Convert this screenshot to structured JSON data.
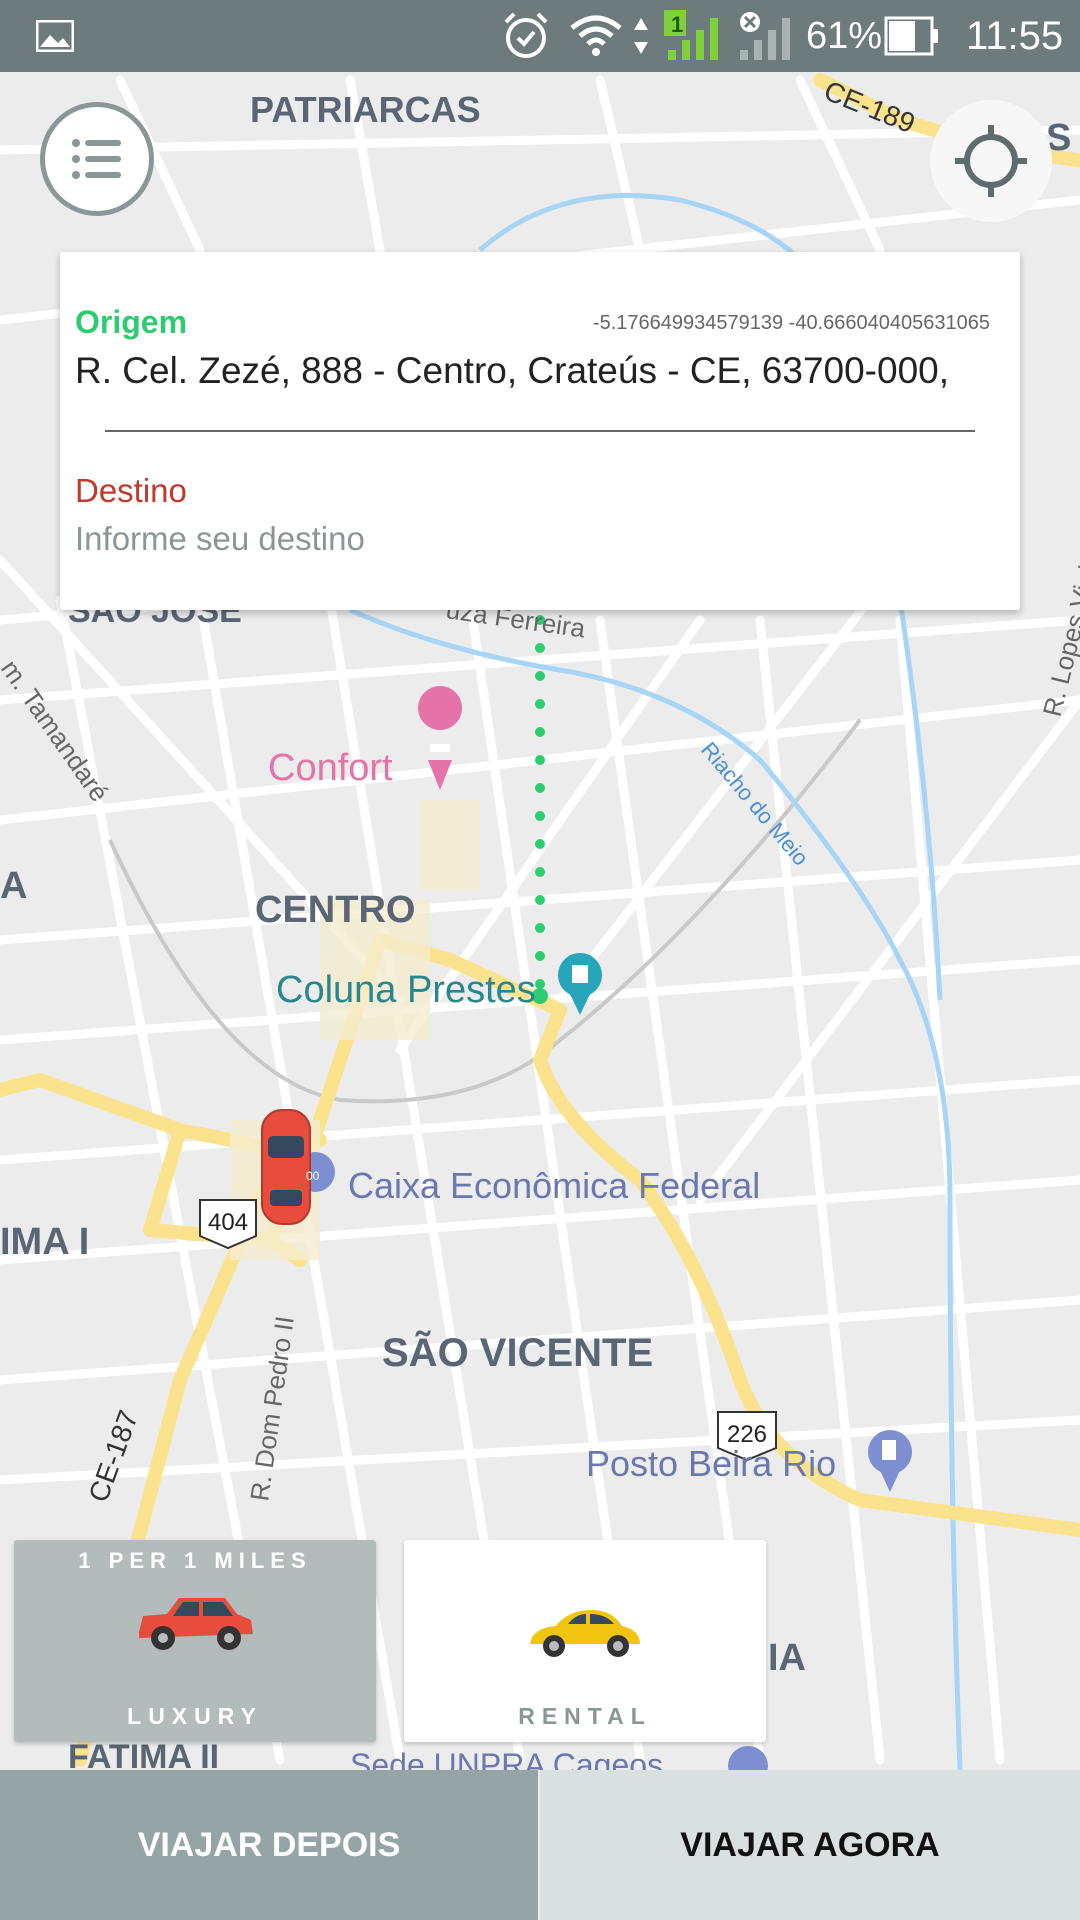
{
  "status_bar": {
    "battery": "61%",
    "time": "11:55",
    "signal_badge": "1"
  },
  "map": {
    "labels": {
      "patriarcas": "PATRIARCAS",
      "ce189": "CE-189",
      "sao_jose": "SÃO JOSÉ",
      "ferreira": "uza Ferreira",
      "tamandare": "m. Tamandaré",
      "confort": "Confort",
      "riacho": "Riacho do Meio",
      "centro": "CENTRO",
      "coluna": "Coluna Prestes",
      "lopes_vieira": "R. Lopes Vieira",
      "caixa": "Caixa Econômica Federal",
      "ima": "IMA I",
      "sao_vicente": "SÃO VICENTE",
      "dom_pedro": "R. Dom Pedro II",
      "ce187": "CE-187",
      "posto": "Posto Beira Rio",
      "fatima": "FATIMA II",
      "sede": "Sede UNPRA Cageos",
      "ia": "IA",
      "left_a": "A",
      "right_s": "S",
      "shield_404": "404",
      "shield_226": "226",
      "badge_00": "00"
    },
    "colors": {
      "road_main": "#fbe38e",
      "water": "#a8d4f5",
      "dots": "#2ecc71",
      "poi_pink": "#e573a8",
      "poi_teal": "#26a6b8",
      "poi_blue": "#7d8fd0"
    }
  },
  "search_card": {
    "origin_label": "Origem",
    "origin_coords": "-5.176649934579139   -40.666040405631065",
    "origin_address": "R. Cel. Zezé, 888 - Centro, Crateús - CE, 63700-000,",
    "destination_label": "Destino",
    "destination_placeholder": "Informe seu destino"
  },
  "vehicle_options": [
    {
      "top_label": "1 PER 1 MILES",
      "label": "LUXURY",
      "selected": true,
      "car_color": "#e74c3c"
    },
    {
      "top_label": "",
      "label": "RENTAL",
      "selected": false,
      "car_color": "#f1c40f"
    }
  ],
  "bottom_buttons": {
    "later": "VIAJAR DEPOIS",
    "now": "VIAJAR AGORA"
  }
}
